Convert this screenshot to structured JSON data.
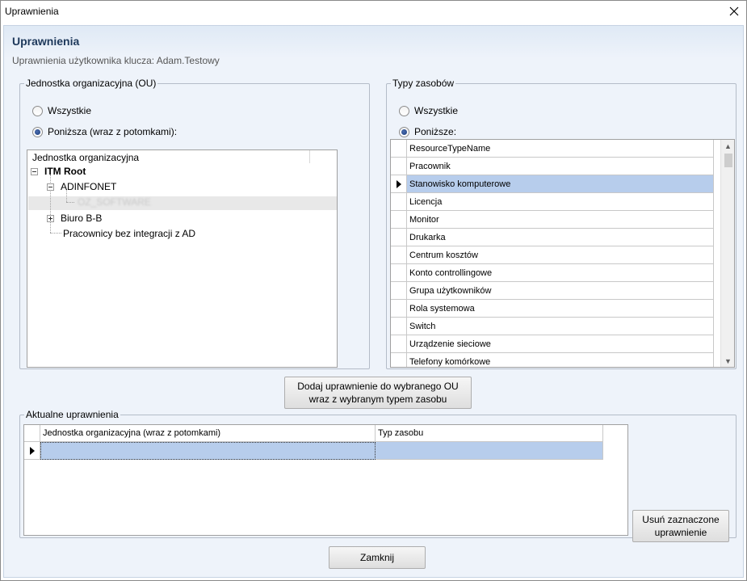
{
  "window": {
    "title": "Uprawnienia"
  },
  "header": {
    "title": "Uprawnienia",
    "subtitle": "Uprawnienia użytkownika klucza: Adam.Testowy"
  },
  "ou_group": {
    "legend": "Jednostka organizacyjna (OU)",
    "radio_all": "Wszystkie",
    "radio_below": "Poniższa (wraz z potomkami):",
    "selected": "below",
    "tree": {
      "header": "Jednostka organizacyjna",
      "root": "ITM Root",
      "nodes": [
        "ADINFONET",
        "OZ_SOFTWARE",
        "Biuro B-B",
        "Pracownicy bez integracji z AD"
      ]
    }
  },
  "resource_group": {
    "legend": "Typy zasobów",
    "radio_all": "Wszystkie",
    "radio_below": "Poniższe:",
    "selected": "below",
    "grid": {
      "column": "ResourceTypeName",
      "rows": [
        "Pracownik",
        "Stanowisko komputerowe",
        "Licencja",
        "Monitor",
        "Drukarka",
        "Centrum kosztów",
        "Konto controllingowe",
        "Grupa użytkowników",
        "Rola systemowa",
        "Switch",
        "Urządzenie sieciowe",
        "Telefony komórkowe"
      ],
      "selected_index": 1
    }
  },
  "add_button": {
    "line1": "Dodaj uprawnienie do wybranego OU",
    "line2": "wraz z wybranym typem zasobu"
  },
  "current_group": {
    "legend": "Aktualne uprawnienia",
    "columns": [
      "Jednostka organizacyjna (wraz z potomkami)",
      "Typ zasobu"
    ],
    "remove_button": {
      "line1": "Usuń zaznaczone",
      "line2": "uprawnienie"
    }
  },
  "close_button": "Zamknij",
  "icons": {
    "close": "close-icon",
    "row_indicator": "triangle-right-icon",
    "expander": "tree-expander-icon"
  },
  "colors": {
    "selection": "#b7cdec",
    "title_blue": "#1e395b",
    "background": "#eef3fa"
  }
}
